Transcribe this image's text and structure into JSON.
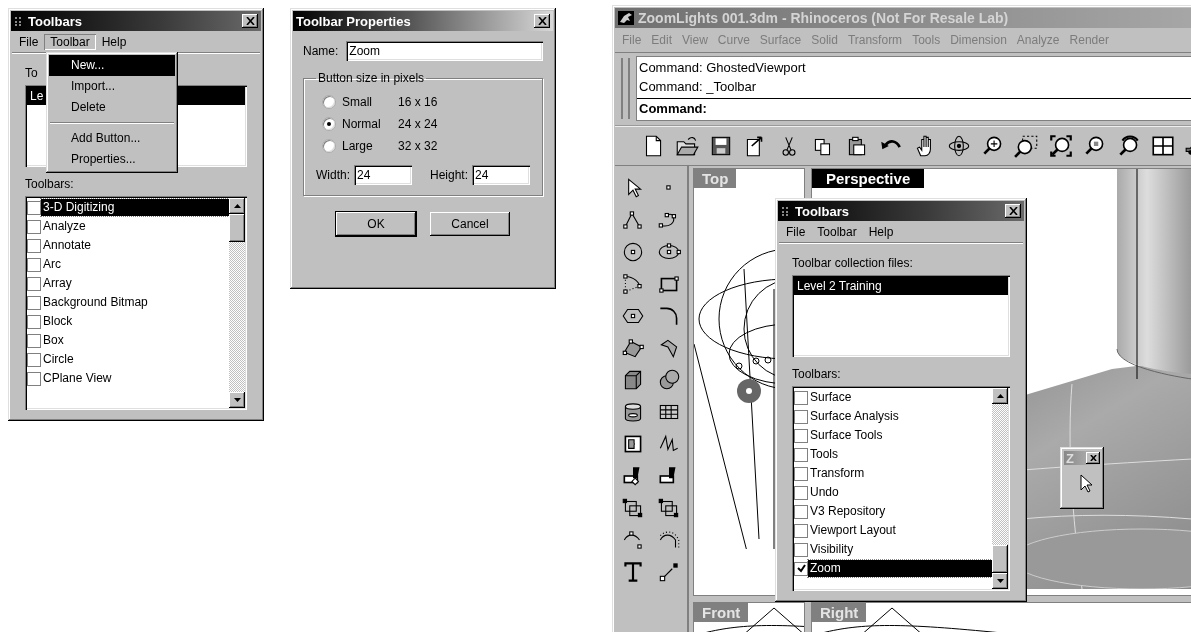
{
  "toolbars_dialog": {
    "title": "Toolbars",
    "menu": [
      {
        "label": "File",
        "open": false
      },
      {
        "label": "Toolbar",
        "open": true
      },
      {
        "label": "Help",
        "open": false
      }
    ],
    "dropdown": [
      {
        "kind": "item",
        "label": "New...",
        "selected": true
      },
      {
        "kind": "item",
        "label": "Import...",
        "selected": false
      },
      {
        "kind": "item",
        "label": "Delete",
        "selected": false
      },
      {
        "kind": "separator"
      },
      {
        "kind": "item",
        "label": "Add Button...",
        "selected": false
      },
      {
        "kind": "item",
        "label": "Properties...",
        "selected": false
      }
    ],
    "collection_label": "To",
    "collection_files": [
      {
        "label": "Le",
        "selected": true
      }
    ],
    "toolbars_label": "Toolbars:",
    "toolbars": [
      {
        "label": "3-D Digitizing",
        "checked": false,
        "selected": true
      },
      {
        "label": "Analyze",
        "checked": false,
        "selected": false
      },
      {
        "label": "Annotate",
        "checked": false,
        "selected": false
      },
      {
        "label": "Arc",
        "checked": false,
        "selected": false
      },
      {
        "label": "Array",
        "checked": false,
        "selected": false
      },
      {
        "label": "Background Bitmap",
        "checked": false,
        "selected": false
      },
      {
        "label": "Block",
        "checked": false,
        "selected": false
      },
      {
        "label": "Box",
        "checked": false,
        "selected": false
      },
      {
        "label": "Circle",
        "checked": false,
        "selected": false
      },
      {
        "label": "CPlane View",
        "checked": false,
        "selected": false
      }
    ]
  },
  "properties_dialog": {
    "title": "Toolbar Properties",
    "name_label": "Name:",
    "name_value": "Zoom",
    "group_title": "Button size in pixels",
    "sizes": [
      {
        "label": "Small",
        "size": "16 x 16",
        "selected": false
      },
      {
        "label": "Normal",
        "size": "24 x 24",
        "selected": true
      },
      {
        "label": "Large",
        "size": "32 x 32",
        "selected": false
      }
    ],
    "width_label": "Width:",
    "width_value": "24",
    "height_label": "Height:",
    "height_value": "24",
    "buttons": [
      "OK",
      "Cancel"
    ]
  },
  "rhino": {
    "title": "ZoomLights 001.3dm - Rhinoceros (Not For Resale Lab)",
    "menu": [
      "File",
      "Edit",
      "View",
      "Curve",
      "Surface",
      "Solid",
      "Transform",
      "Tools",
      "Dimension",
      "Analyze",
      "Render"
    ],
    "command_history": [
      "Command: GhostedViewport",
      "Command: _Toolbar"
    ],
    "command_prompt": "Command:",
    "viewports": [
      {
        "label": "Top",
        "active": false
      },
      {
        "label": "Perspective",
        "active": true
      },
      {
        "label": "Front",
        "active": false
      },
      {
        "label": "Right",
        "active": false
      }
    ],
    "toolbars_dialog": {
      "title": "Toolbars",
      "menu": [
        "File",
        "Toolbar",
        "Help"
      ],
      "collection_label": "Toolbar collection files:",
      "collection_files": [
        {
          "label": "Level 2 Training",
          "selected": true
        }
      ],
      "toolbars_label": "Toolbars:",
      "toolbars": [
        {
          "label": "Surface",
          "checked": false,
          "selected": false
        },
        {
          "label": "Surface Analysis",
          "checked": false,
          "selected": false
        },
        {
          "label": "Surface Tools",
          "checked": false,
          "selected": false
        },
        {
          "label": "Tools",
          "checked": false,
          "selected": false
        },
        {
          "label": "Transform",
          "checked": false,
          "selected": false
        },
        {
          "label": "Undo",
          "checked": false,
          "selected": false
        },
        {
          "label": "V3 Repository",
          "checked": false,
          "selected": false
        },
        {
          "label": "Viewport Layout",
          "checked": false,
          "selected": false
        },
        {
          "label": "Visibility",
          "checked": false,
          "selected": false
        },
        {
          "label": "Zoom",
          "checked": true,
          "selected": true
        }
      ]
    },
    "floating_toolbar": {
      "title": "Z"
    }
  }
}
